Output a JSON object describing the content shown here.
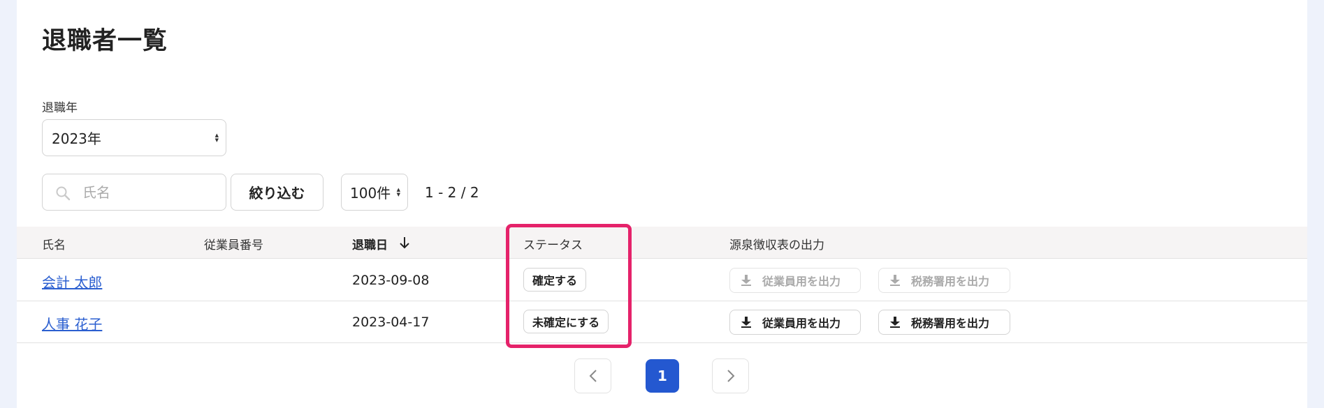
{
  "page": {
    "title": "退職者一覧"
  },
  "filters": {
    "year_label": "退職年",
    "year_value": "2023年",
    "search_placeholder": "氏名",
    "search_value": "",
    "filter_button_label": "絞り込む",
    "per_page_value": "100件",
    "range_text": "1 - 2 / 2"
  },
  "table": {
    "headers": {
      "name": "氏名",
      "employee_number": "従業員番号",
      "retirement_date": "退職日",
      "status": "ステータス",
      "withholding_export": "源泉徴収表の出力"
    },
    "sort": {
      "column": "retirement_date",
      "direction": "desc",
      "icon": "arrow-down-icon"
    },
    "rows": [
      {
        "name": "会計 太郎",
        "employee_number": "",
        "retirement_date": "2023-09-08",
        "status_action": "確定する",
        "export_employee_label": "従業員用を出力",
        "export_tax_label": "税務署用を出力",
        "export_enabled": false
      },
      {
        "name": "人事 花子",
        "employee_number": "",
        "retirement_date": "2023-04-17",
        "status_action": "未確定にする",
        "export_employee_label": "従業員用を出力",
        "export_tax_label": "税務署用を出力",
        "export_enabled": true
      }
    ]
  },
  "pagination": {
    "current_page": "1",
    "prev_icon": "chevron-left-icon",
    "next_icon": "chevron-right-icon"
  },
  "colors": {
    "link": "#2b5fd0",
    "primary": "#2458d0",
    "highlight": "#e5226a",
    "background": "#eef2fb",
    "table_header_bg": "#f6f4f4",
    "disabled_text": "#aaaaaa"
  }
}
